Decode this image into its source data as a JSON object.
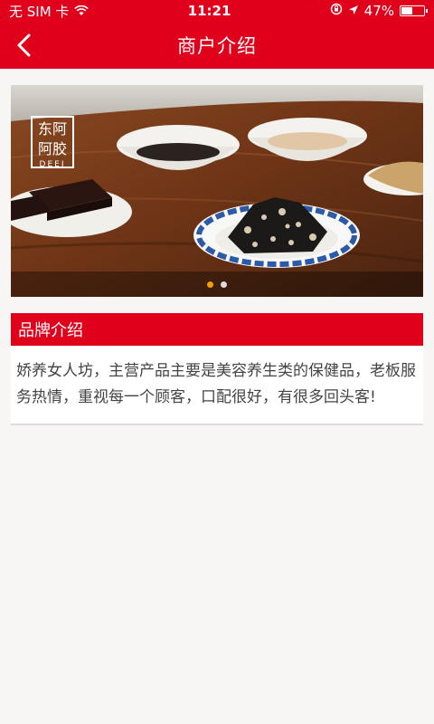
{
  "status_bar": {
    "carrier": "无 SIM 卡",
    "time": "11:21",
    "battery": "47%",
    "battery_level": 0.47
  },
  "navbar": {
    "title": "商户介绍",
    "back_icon": "chevron-left-icon"
  },
  "banner": {
    "logo_text_line1": "东阿",
    "logo_text_line2": "阿胶",
    "logo_brand": "DEEJ",
    "dots": 2,
    "active_dot": 0
  },
  "brand_section": {
    "title": "品牌介绍",
    "description": "娇养女人坊，主营产品主要是美容养生类的保健品，老板服务热情，重视每一个顾客，口配很好，有很多回头客!"
  },
  "colors": {
    "primary_red": "#e0001b",
    "dot_active": "#f0a000"
  }
}
